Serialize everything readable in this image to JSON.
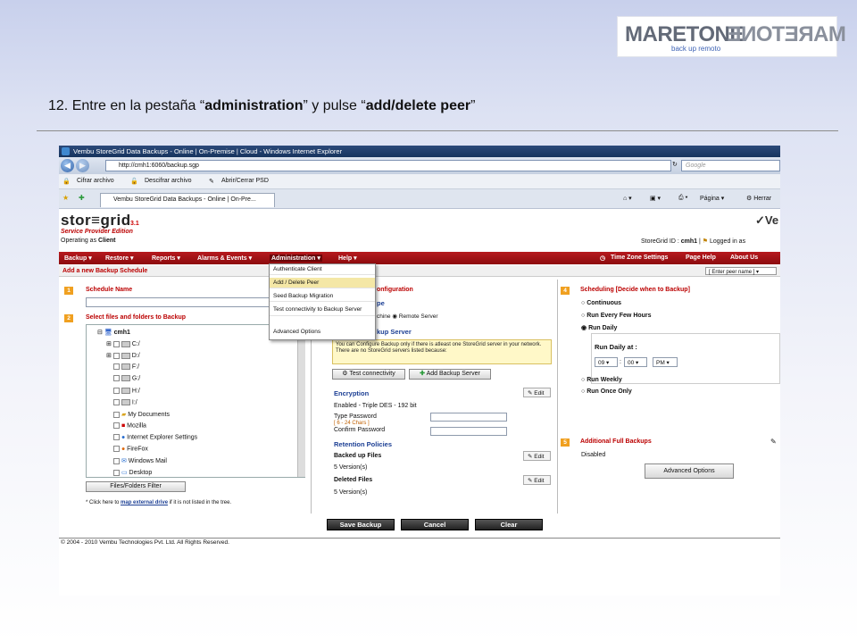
{
  "slide": {
    "logo_main": "MARETONE",
    "logo_sub": "back up remoto",
    "instruction_prefix": "12. Entre en la pestaña “",
    "instruction_b1": "administration",
    "instruction_mid": "” y pulse “",
    "instruction_b2": "add/delete peer",
    "instruction_suffix": "”"
  },
  "browser": {
    "title": "Vembu StoreGrid Data Backups - Online | On-Premise | Cloud - Windows Internet Explorer",
    "url": "http://cmh1:6060/backup.sgp",
    "search_placeholder": "Google",
    "links": [
      "Cifrar archivo",
      "Descifrar archivo",
      "Abrir/Cerrar PSD"
    ],
    "tab_title": "Vembu StoreGrid Data Backups - Online | On-Pre...",
    "page_menu": "Página",
    "tools_menu": "Herrar"
  },
  "app": {
    "brand": "stor≡grid",
    "version": "3.1",
    "edition": "Service Provider Edition",
    "operating_label": "Operating as ",
    "operating_value": "Client",
    "storegrid_id_label": "StoreGrid ID : ",
    "storegrid_id": "cmh1",
    "logged_in": "Logged in as",
    "vendor": "Ve",
    "menu": [
      "Backup ▾",
      "Restore ▾",
      "Reports ▾",
      "Alarms & Events ▾",
      "Administration ▾",
      "Help ▾"
    ],
    "right_menu": [
      "Time Zone Settings",
      "Page Help",
      "About Us"
    ],
    "subtitle": "Add a new Backup Schedule",
    "peer_select": "[ Enter peer name ]",
    "admin_dropdown": [
      "Authenticate Client",
      "Add / Delete Peer",
      "Seed Backup Migration",
      "Test connectivity to Backup Server",
      "Advanced Options"
    ],
    "step1": "Schedule Name",
    "step2": "Select files and folders to Backup",
    "tree": [
      "cmh1",
      "C:/",
      "D:/",
      "F:/",
      "G:/",
      "H:/",
      "I:/",
      "My Documents",
      "Mozilla",
      "Internet Explorer Settings",
      "FireFox",
      "Windows Mail",
      "Desktop"
    ],
    "filter_btn": "Files/Folders Filter",
    "click_note_pre": "* Click here to ",
    "click_note_link": "map external drive",
    "click_note_post": " if it is not listed in the tree.",
    "step3_title": "onfiguration",
    "step3_type": "pe",
    "radio_machine": "chine",
    "radio_remote": "Remote Server",
    "backup_server": "kup Server",
    "info_text": "You can Configure Backup only if there is atleast one StoreGrid server in your network. There are no StoreGrid servers listed because:",
    "test_conn": "Test connectivity",
    "add_server": "Add Backup Server",
    "encryption": "Encryption",
    "edit": "Edit",
    "enc_status": "Enabled  - Triple DES  -  192  bit",
    "type_pw": "Type Password",
    "pw_hint": "[ 6 - 24 Chars ]",
    "confirm_pw": "Confirm Password",
    "retention": "Retention Policies",
    "backed_up": "Backed up Files",
    "backed_versions": "5  Version(s)",
    "deleted": "Deleted Files",
    "deleted_versions": "5  Version(s)",
    "step4": "Scheduling [Decide when to Backup]",
    "sched_opts": [
      "Continuous",
      "Run Every Few Hours",
      "Run Daily"
    ],
    "run_daily_at": "Run Daily at :",
    "hour": "09",
    "minute": "00",
    "ampm": "PM",
    "sched_opts2": [
      "Run Weekly",
      "Run Once Only"
    ],
    "step5": "Additional Full Backups",
    "disabled": "Disabled",
    "adv_options": "Advanced Options",
    "save": "Save Backup",
    "cancel": "Cancel",
    "clear": "Clear",
    "footer": "© 2004 - 2010 Vembu Technologies Pvt. Ltd. All Rights Reserved."
  }
}
